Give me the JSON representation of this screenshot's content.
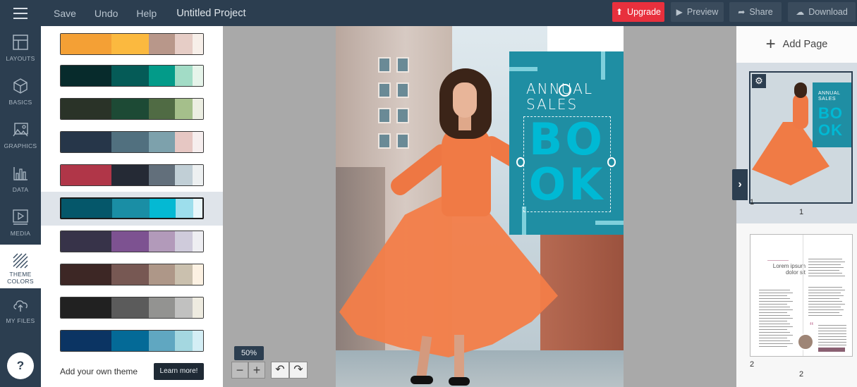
{
  "topbar": {
    "menu": [
      "Save",
      "Undo",
      "Help"
    ],
    "project_title": "Untitled Project",
    "upgrade_label": "Upgrade",
    "preview_label": "Preview",
    "share_label": "Share",
    "download_label": "Download"
  },
  "rail": {
    "items": [
      {
        "label": "LAYOUTS",
        "icon": "layout-icon"
      },
      {
        "label": "BASICS",
        "icon": "cube-icon"
      },
      {
        "label": "GRAPHICS",
        "icon": "image-icon"
      },
      {
        "label": "DATA",
        "icon": "chart-icon"
      },
      {
        "label": "MEDIA",
        "icon": "play-icon"
      },
      {
        "label": "THEME\nCOLORS",
        "icon": "stripes-icon"
      },
      {
        "label": "MY FILES",
        "icon": "cloud-upload-icon"
      }
    ],
    "active_index": 5,
    "help_label": "?"
  },
  "theme_panel": {
    "palettes": [
      [
        "#f4a035",
        "#fbb93f",
        "#b8978a",
        "#e6cdc6",
        "#f7efe9"
      ],
      [
        "#072b2c",
        "#055b57",
        "#039b89",
        "#a2dcc6",
        "#e6f4ea"
      ],
      [
        "#2a3328",
        "#1d4a35",
        "#506b44",
        "#a5bf8b",
        "#eceee2"
      ],
      [
        "#263649",
        "#51707f",
        "#7da1ac",
        "#e6c7c3",
        "#f6eeee"
      ],
      [
        "#b03648",
        "#252a35",
        "#626f7b",
        "#c1cfd6",
        "#edf0f1"
      ],
      [
        "#05576a",
        "#1a8ea5",
        "#04b9d3",
        "#9ddeec",
        "#e8f6fa"
      ],
      [
        "#373349",
        "#7d5291",
        "#b29aba",
        "#cfcbdb",
        "#eeeef2"
      ],
      [
        "#3d2725",
        "#775853",
        "#ae9788",
        "#cac0ae",
        "#fcf1e2"
      ],
      [
        "#212121",
        "#5b5b5b",
        "#939391",
        "#c1c1c0",
        "#eeebe0"
      ],
      [
        "#0b3463",
        "#046a97",
        "#60a7c1",
        "#a4d7e0",
        "#d4eef5"
      ]
    ],
    "selected_index": 5,
    "add_theme_label": "Add your own theme",
    "learn_more_label": "Learn more!"
  },
  "canvas": {
    "heading_line1": "ANNUAL",
    "heading_line2": "SALES",
    "big_line1": "BO",
    "big_line2": "OK",
    "zoom_label": "50%",
    "zoom_out": "−",
    "zoom_in": "+",
    "undo_glyph": "↶",
    "redo_glyph": "↷"
  },
  "pages_panel": {
    "add_page_label": "Add Page",
    "add_page_glyph": "+",
    "collapse_glyph": "›",
    "settings_glyph": "⚙",
    "page1": {
      "number": "1",
      "caption": "1",
      "mini_heading": "ANNUAL\nSALES",
      "mini_big": "BO\nOK"
    },
    "page2": {
      "number": "2",
      "caption": "2",
      "mini_title": "Lorem ipsum\ndolor sit",
      "quote_glyph": "“"
    }
  },
  "colors": {
    "topbar": "#2c3e50",
    "upgrade": "#e8303d",
    "accent_teal": "#1f8ea3",
    "book_cyan": "#00b9d4"
  }
}
